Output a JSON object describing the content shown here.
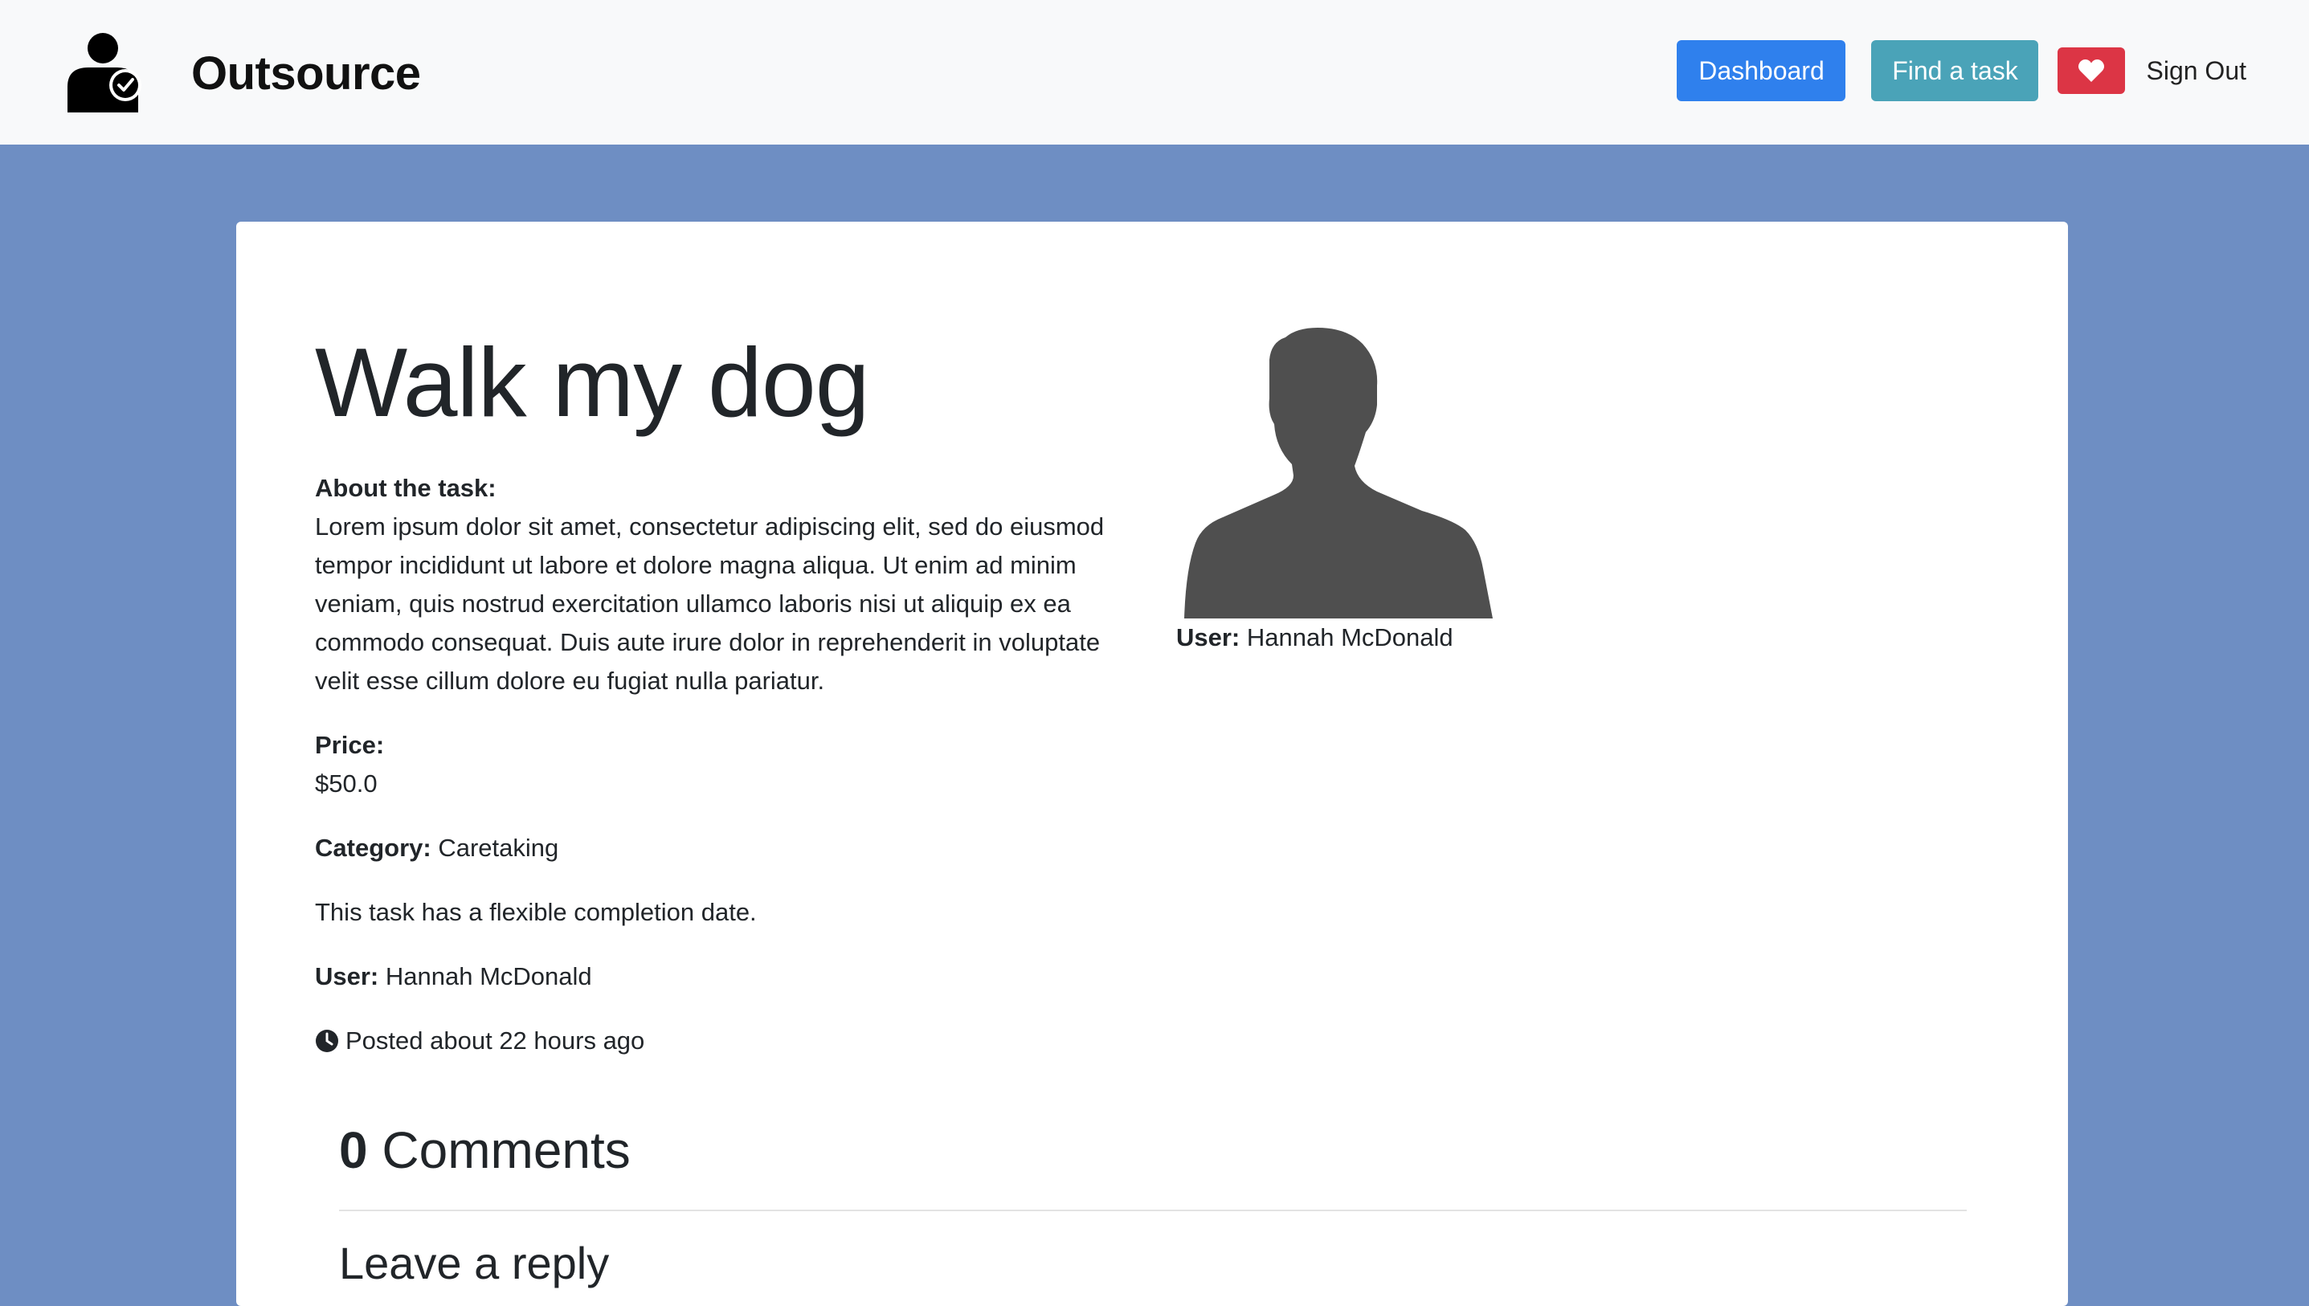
{
  "brand": {
    "name": "Outsource",
    "logo_icon": "user-check-icon"
  },
  "nav": {
    "dashboard_label": "Dashboard",
    "find_task_label": "Find a task",
    "favorites_icon": "heart-icon",
    "sign_out_label": "Sign Out"
  },
  "task": {
    "title": "Walk my dog",
    "about_label": "About the task:",
    "description": "Lorem ipsum dolor sit amet, consectetur adipiscing elit, sed do eiusmod tempor incididunt ut labore et dolore magna aliqua. Ut enim ad minim veniam, quis nostrud exercitation ullamco laboris nisi ut aliquip ex ea commodo consequat. Duis aute irure dolor in reprehenderit in voluptate velit esse cillum dolore eu fugiat nulla pariatur.",
    "price_label": "Price:",
    "price_value": "$50.0",
    "category_label": "Category:",
    "category_value": "Caretaking",
    "completion_note": "This task has a flexible completion date.",
    "user_label": "User:",
    "user_value": "Hannah McDonald",
    "posted_text": "Posted about 22 hours ago"
  },
  "poster": {
    "avatar_icon": "user-silhouette-icon",
    "user_label": "User:",
    "user_value": "Hannah McDonald"
  },
  "comments": {
    "count": "0",
    "label": "Comments",
    "reply_title": "Leave a reply"
  },
  "colors": {
    "background": "#6e8ec3",
    "navbar": "#f8f9fa",
    "dashboard_button": "#2f80ed",
    "find_button": "#4aa3b8",
    "heart_button": "#dc3545",
    "avatar": "#4f4f4f"
  }
}
